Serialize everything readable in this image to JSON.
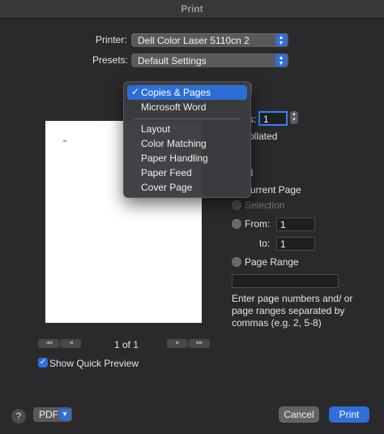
{
  "window": {
    "title": "Print"
  },
  "printer": {
    "label": "Printer:",
    "value": "Dell Color Laser 5110cn 2"
  },
  "presets": {
    "label": "Presets:",
    "value": "Default Settings"
  },
  "menu": {
    "items": [
      {
        "label": "Copies & Pages",
        "selected": true
      },
      {
        "label": "Microsoft Word"
      },
      {
        "label": "Layout"
      },
      {
        "label": "Color Matching"
      },
      {
        "label": "Paper Handling"
      },
      {
        "label": "Paper Feed"
      },
      {
        "label": "Cover Page"
      }
    ],
    "checkmark": "✓"
  },
  "preview": {
    "page_text": "Itti"
  },
  "copies": {
    "label_fragment": "s:",
    "value": "1",
    "collated_fragment": "ollated"
  },
  "pages": {
    "all_fragment": "ll",
    "current_page_fragment": "urrent Page",
    "selection": "Selection",
    "from_label": "From:",
    "from_value": "1",
    "to_label": "to:",
    "to_value": "1",
    "page_range": "Page Range",
    "range_value": "",
    "hint": "Enter page numbers and/ or page ranges separated by commas (e.g. 2, 5-8)"
  },
  "navigation": {
    "page_indicator": "1 of 1",
    "first": "◀◀",
    "prev": "◀",
    "next": "▶",
    "last": "▶▶"
  },
  "quick_preview": {
    "label": "Show Quick Preview",
    "checked": true
  },
  "footer": {
    "help": "?",
    "pdf": "PDF",
    "cancel": "Cancel",
    "print": "Print"
  },
  "colors": {
    "accent": "#2f6fdc",
    "background": "#2a2a2c"
  }
}
